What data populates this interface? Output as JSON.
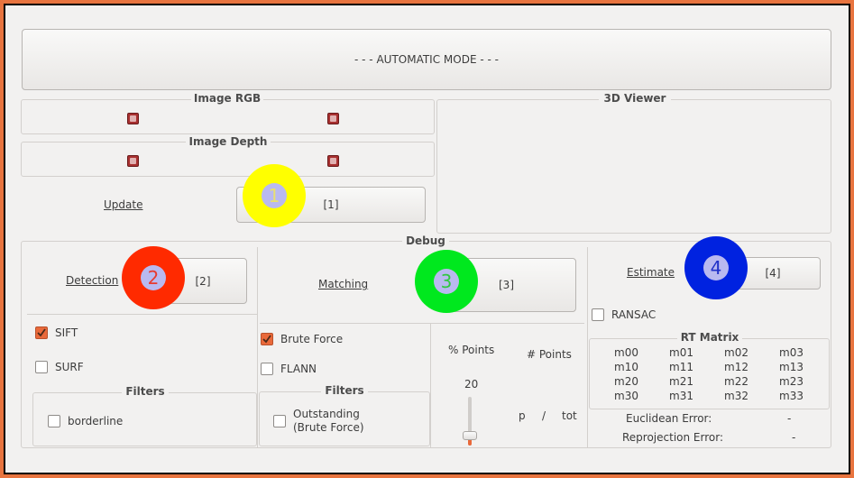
{
  "auto_mode_label": "- - - AUTOMATIC MODE - - -",
  "image_rgb_title": "Image RGB",
  "image_depth_title": "Image Depth",
  "viewer_title": "3D Viewer",
  "update_label": "Update",
  "update_button": "[1]",
  "debug_title": "Debug",
  "detection": {
    "label": "Detection",
    "button": "[2]",
    "sift": "SIFT",
    "surf": "SURF",
    "filters_title": "Filters",
    "borderline": "borderline"
  },
  "matching": {
    "label": "Matching",
    "button": "[3]",
    "brute_force": "Brute Force",
    "flann": "FLANN",
    "filters_title": "Filters",
    "outstanding_line1": "Outstanding",
    "outstanding_line2": "(Brute Force)",
    "pct_points": "% Points",
    "num_points": "# Points",
    "slider_value": "20",
    "slider_fraction": 0.2,
    "p": "p",
    "slash": "/",
    "tot": "tot"
  },
  "estimate": {
    "label": "Estimate",
    "button": "[4]",
    "ransac": "RANSAC",
    "rt_title": "RT Matrix",
    "matrix": [
      [
        "m00",
        "m01",
        "m02",
        "m03"
      ],
      [
        "m10",
        "m11",
        "m12",
        "m13"
      ],
      [
        "m20",
        "m21",
        "m22",
        "m23"
      ],
      [
        "m30",
        "m31",
        "m32",
        "m33"
      ]
    ],
    "euclid_label": "Euclidean Error:",
    "euclid_value": "-",
    "reproj_label": "Reprojection Error:",
    "reproj_value": "-"
  },
  "markers": [
    {
      "num": "1",
      "color": "#ffff00",
      "text_color": "#e8e070"
    },
    {
      "num": "2",
      "color": "#ff2a00",
      "text_color": "#e83a30"
    },
    {
      "num": "3",
      "color": "#00e81e",
      "text_color": "#30c840"
    },
    {
      "num": "4",
      "color": "#0022e0",
      "text_color": "#2030c8"
    }
  ],
  "colors": {
    "border_outer": "#e8743f",
    "window_bg": "#f2f1f0",
    "checkbox_on": "#e9693a"
  }
}
